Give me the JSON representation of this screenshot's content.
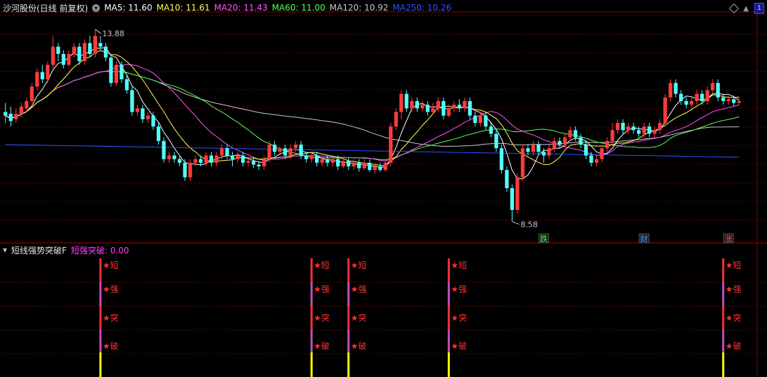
{
  "header": {
    "title": "沙河股份(日线 前复权)",
    "ma_items": [
      {
        "label": "MA5: 11.60",
        "color": "#ffffff"
      },
      {
        "label": "MA10: 11.61",
        "color": "#ffff55"
      },
      {
        "label": "MA20: 11.43",
        "color": "#ff55ff"
      },
      {
        "label": "MA60: 11.00",
        "color": "#55ff55"
      },
      {
        "label": "MA120: 10.92",
        "color": "#c8c8c8"
      },
      {
        "label": "MA250: 10.26",
        "color": "#3050ff"
      }
    ],
    "corner_badge": "1"
  },
  "indicator": {
    "name": "短线强势突破F",
    "value_label": "短强突破: 0.00",
    "value_color": "#ff40ff"
  },
  "chart_data": {
    "type": "candlestick",
    "price_range": [
      8.3,
      14.3
    ],
    "high_label": "13.88",
    "low_label": "8.58",
    "up_color": "#ff3b3b",
    "down_color": "#54ffff",
    "ma_colors": {
      "MA5": "#ffffff",
      "MA10": "#ffff55",
      "MA20": "#ff55ff",
      "MA60": "#55ff55",
      "MA120": "#c8c8c8",
      "MA250": "#3050ff"
    },
    "candles": [
      [
        11.6,
        11.5,
        11.85,
        11.3
      ],
      [
        11.55,
        11.35,
        11.75,
        11.2
      ],
      [
        11.4,
        11.55,
        11.7,
        11.3
      ],
      [
        11.55,
        11.75,
        11.85,
        11.45
      ],
      [
        11.7,
        11.9,
        12.0,
        11.6
      ],
      [
        11.9,
        12.3,
        12.4,
        11.85
      ],
      [
        12.3,
        12.7,
        12.8,
        12.2
      ],
      [
        12.7,
        12.5,
        12.9,
        12.4
      ],
      [
        12.5,
        12.9,
        13.0,
        12.4
      ],
      [
        12.9,
        13.4,
        13.7,
        12.8
      ],
      [
        13.4,
        13.2,
        13.5,
        13.0
      ],
      [
        13.2,
        12.9,
        13.3,
        12.8
      ],
      [
        12.9,
        13.2,
        13.3,
        12.85
      ],
      [
        13.2,
        13.4,
        13.5,
        13.1
      ],
      [
        13.4,
        13.0,
        13.5,
        12.9
      ],
      [
        13.0,
        13.5,
        13.6,
        12.9
      ],
      [
        13.5,
        13.2,
        13.7,
        13.1
      ],
      [
        13.2,
        13.7,
        13.88,
        13.1
      ],
      [
        13.5,
        13.4,
        13.7,
        13.3
      ],
      [
        13.4,
        13.1,
        13.5,
        13.0
      ],
      [
        13.1,
        12.4,
        13.2,
        12.3
      ],
      [
        12.4,
        12.9,
        13.0,
        12.3
      ],
      [
        12.9,
        12.5,
        13.0,
        12.4
      ],
      [
        12.5,
        12.2,
        12.6,
        12.1
      ],
      [
        12.2,
        11.6,
        12.3,
        11.5
      ],
      [
        11.6,
        11.7,
        11.8,
        11.5
      ],
      [
        11.7,
        11.4,
        11.8,
        11.3
      ],
      [
        11.4,
        11.5,
        11.6,
        11.3
      ],
      [
        11.5,
        11.2,
        11.6,
        11.1
      ],
      [
        11.2,
        10.8,
        11.3,
        10.7
      ],
      [
        10.8,
        10.3,
        10.9,
        10.2
      ],
      [
        10.3,
        10.4,
        10.5,
        10.2
      ],
      [
        10.4,
        10.3,
        10.5,
        10.2
      ],
      [
        10.3,
        10.2,
        10.4,
        10.1
      ],
      [
        10.2,
        9.8,
        10.3,
        9.7
      ],
      [
        9.8,
        10.2,
        10.3,
        9.7
      ],
      [
        10.2,
        10.3,
        10.4,
        10.1
      ],
      [
        10.3,
        10.2,
        10.4,
        10.1
      ],
      [
        10.2,
        10.4,
        10.5,
        10.1
      ],
      [
        10.4,
        10.2,
        10.5,
        10.1
      ],
      [
        10.2,
        10.4,
        10.5,
        10.1
      ],
      [
        10.4,
        10.6,
        10.7,
        10.3
      ],
      [
        10.6,
        10.4,
        10.7,
        10.3
      ],
      [
        10.4,
        10.3,
        10.5,
        10.1
      ],
      [
        10.3,
        10.4,
        10.5,
        10.2
      ],
      [
        10.4,
        10.2,
        10.5,
        10.1
      ],
      [
        10.2,
        10.25,
        10.35,
        10.1
      ],
      [
        10.25,
        10.15,
        10.35,
        10.05
      ],
      [
        10.15,
        10.1,
        10.25,
        10.0
      ],
      [
        10.1,
        10.3,
        10.4,
        10.0
      ],
      [
        10.3,
        10.7,
        10.8,
        10.2
      ],
      [
        10.7,
        10.5,
        10.8,
        10.4
      ],
      [
        10.5,
        10.6,
        10.65,
        10.4
      ],
      [
        10.6,
        10.4,
        10.7,
        10.3
      ],
      [
        10.4,
        10.6,
        10.7,
        10.3
      ],
      [
        10.6,
        10.7,
        10.8,
        10.5
      ],
      [
        10.7,
        10.4,
        10.8,
        10.3
      ],
      [
        10.4,
        10.3,
        10.5,
        10.2
      ],
      [
        10.3,
        10.4,
        10.5,
        10.2
      ],
      [
        10.4,
        10.2,
        10.5,
        10.1
      ],
      [
        10.2,
        10.3,
        10.4,
        10.1
      ],
      [
        10.3,
        10.2,
        10.4,
        10.1
      ],
      [
        10.2,
        10.3,
        10.35,
        10.1
      ],
      [
        10.3,
        10.1,
        10.4,
        10.0
      ],
      [
        10.1,
        10.25,
        10.35,
        10.05
      ],
      [
        10.25,
        10.1,
        10.35,
        10.0
      ],
      [
        10.1,
        10.2,
        10.3,
        10.0
      ],
      [
        10.2,
        10.05,
        10.3,
        9.95
      ],
      [
        10.05,
        10.2,
        10.3,
        10.0
      ],
      [
        10.2,
        10.0,
        10.3,
        9.95
      ],
      [
        10.0,
        10.1,
        10.2,
        9.9
      ],
      [
        10.1,
        10.0,
        10.2,
        9.95
      ],
      [
        10.0,
        10.2,
        10.3,
        9.95
      ],
      [
        10.2,
        11.2,
        11.3,
        10.1
      ],
      [
        11.2,
        11.6,
        11.7,
        11.1
      ],
      [
        11.6,
        12.1,
        12.2,
        11.4
      ],
      [
        12.1,
        11.7,
        12.2,
        11.6
      ],
      [
        11.7,
        11.9,
        12.0,
        11.6
      ],
      [
        11.9,
        11.7,
        12.0,
        11.6
      ],
      [
        11.7,
        11.8,
        11.9,
        11.6
      ],
      [
        11.8,
        11.6,
        11.9,
        11.5
      ],
      [
        11.6,
        11.7,
        11.85,
        11.55
      ],
      [
        11.7,
        11.9,
        12.0,
        11.6
      ],
      [
        11.9,
        11.5,
        12.0,
        11.4
      ],
      [
        11.5,
        11.7,
        11.8,
        11.45
      ],
      [
        11.7,
        11.8,
        11.9,
        11.6
      ],
      [
        11.8,
        11.7,
        11.95,
        11.6
      ],
      [
        11.7,
        11.9,
        12.0,
        11.6
      ],
      [
        11.9,
        11.5,
        12.0,
        11.4
      ],
      [
        11.5,
        11.3,
        11.6,
        11.2
      ],
      [
        11.3,
        11.5,
        11.6,
        11.2
      ],
      [
        11.5,
        11.2,
        11.6,
        11.1
      ],
      [
        11.2,
        11.0,
        11.3,
        10.9
      ],
      [
        11.0,
        10.6,
        11.1,
        10.5
      ],
      [
        10.6,
        10.0,
        10.7,
        9.9
      ],
      [
        10.0,
        9.5,
        10.1,
        9.4
      ],
      [
        9.5,
        8.9,
        9.6,
        8.58
      ],
      [
        8.9,
        9.8,
        9.9,
        8.8
      ],
      [
        9.8,
        10.6,
        10.7,
        9.7
      ],
      [
        10.6,
        10.5,
        10.7,
        10.4
      ],
      [
        10.5,
        10.7,
        10.8,
        10.4
      ],
      [
        10.7,
        10.5,
        10.8,
        10.4
      ],
      [
        10.5,
        10.4,
        10.6,
        10.2
      ],
      [
        10.4,
        10.6,
        10.7,
        10.3
      ],
      [
        10.6,
        10.8,
        10.9,
        10.5
      ],
      [
        10.8,
        10.7,
        10.9,
        10.6
      ],
      [
        10.7,
        10.9,
        11.0,
        10.6
      ],
      [
        10.9,
        11.1,
        11.2,
        10.8
      ],
      [
        11.1,
        10.9,
        11.2,
        10.8
      ],
      [
        10.9,
        10.7,
        11.0,
        10.6
      ],
      [
        10.7,
        10.4,
        10.8,
        10.3
      ],
      [
        10.4,
        10.2,
        10.5,
        10.1
      ],
      [
        10.2,
        10.3,
        10.4,
        10.1
      ],
      [
        10.3,
        10.6,
        10.7,
        10.2
      ],
      [
        10.6,
        10.8,
        10.9,
        10.5
      ],
      [
        10.8,
        11.1,
        11.3,
        10.7
      ],
      [
        11.1,
        11.3,
        11.4,
        11.0
      ],
      [
        11.3,
        11.1,
        11.4,
        11.0
      ],
      [
        11.1,
        11.2,
        11.3,
        11.0
      ],
      [
        11.2,
        11.1,
        11.3,
        11.0
      ],
      [
        11.1,
        11.0,
        11.2,
        10.9
      ],
      [
        11.0,
        11.2,
        11.3,
        10.9
      ],
      [
        11.2,
        11.0,
        11.3,
        10.9
      ],
      [
        11.0,
        11.1,
        11.2,
        10.9
      ],
      [
        11.1,
        11.3,
        11.4,
        11.0
      ],
      [
        11.3,
        12.0,
        12.1,
        11.2
      ],
      [
        12.0,
        12.4,
        12.5,
        11.9
      ],
      [
        12.4,
        12.1,
        12.5,
        12.0
      ],
      [
        12.1,
        11.9,
        12.2,
        11.8
      ],
      [
        11.9,
        11.8,
        12.0,
        11.7
      ],
      [
        11.8,
        11.9,
        12.0,
        11.7
      ],
      [
        11.9,
        12.1,
        12.2,
        11.8
      ],
      [
        12.1,
        11.9,
        12.2,
        11.8
      ],
      [
        11.9,
        12.2,
        12.3,
        11.8
      ],
      [
        12.2,
        12.4,
        12.5,
        12.1
      ],
      [
        12.4,
        12.0,
        12.5,
        11.9
      ],
      [
        12.0,
        11.9,
        12.1,
        11.8
      ],
      [
        11.9,
        11.95,
        12.05,
        11.8
      ],
      [
        11.95,
        11.85,
        12.05,
        11.75
      ],
      [
        11.85,
        11.9,
        12.0,
        11.8
      ]
    ],
    "markers": [
      {
        "index": 102,
        "label": "跌",
        "color": "#44ff44"
      },
      {
        "index": 121,
        "label": "财",
        "color": "#44aaff"
      },
      {
        "index": 137,
        "label": "涨",
        "color": "#ff4444"
      }
    ],
    "signals": {
      "bars": [
        18,
        58,
        65,
        84,
        136
      ],
      "labels": [
        "★短",
        "★强",
        "★突",
        "★破"
      ],
      "label_color": "#ff3030",
      "segment_colors": [
        "#ff3030",
        "#c050c0",
        "#ff3030",
        "#c050c0",
        "#ffff00"
      ]
    }
  }
}
